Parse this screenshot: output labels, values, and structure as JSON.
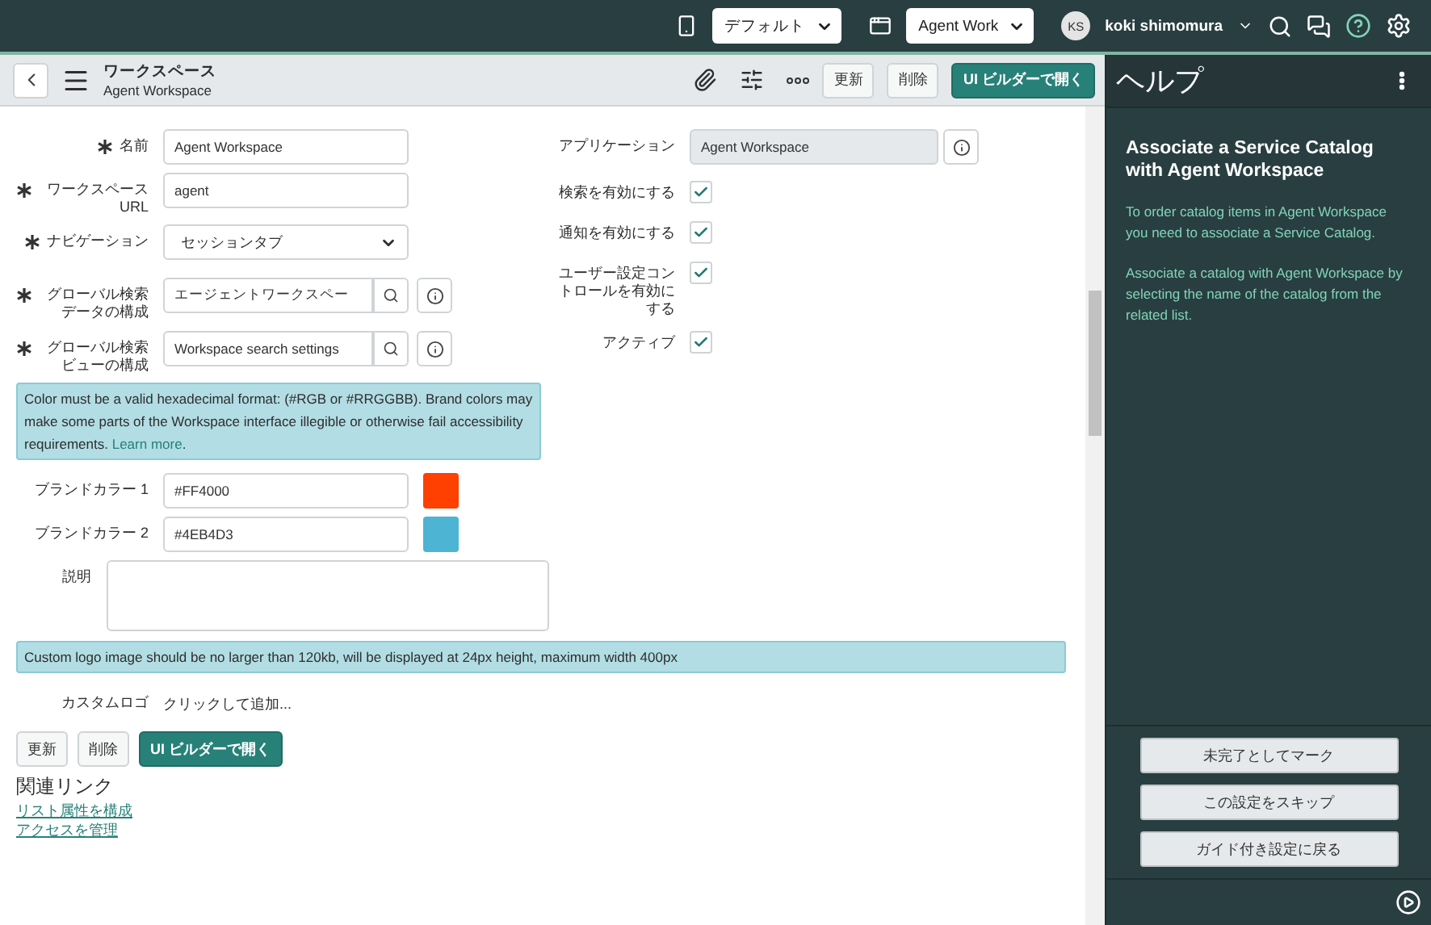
{
  "topbar": {
    "update_set": "デフォルト",
    "application": "Agent Work",
    "user_initials": "KS",
    "user_name": "koki shimomura"
  },
  "header": {
    "title": "ワークスペース",
    "subtitle": "Agent Workspace",
    "buttons": [
      "更新",
      "削除"
    ],
    "primary_button": "UI ビルダーで開く"
  },
  "left_fields": [
    {
      "kind": "text",
      "label": "名前",
      "required": true,
      "value": "Agent Workspace"
    },
    {
      "kind": "text",
      "label": "ワークスペース URL",
      "required": true,
      "value": "agent"
    },
    {
      "kind": "select",
      "label": "ナビゲーション",
      "required": true,
      "value": "セッションタブ"
    },
    {
      "kind": "reference",
      "label": "グローバル検索データの構成",
      "required": true,
      "value": "エージェントワークスペー"
    },
    {
      "kind": "reference",
      "label": "グローバル検索ビューの構成",
      "required": true,
      "value": "Workspace search settings"
    }
  ],
  "right_fields": [
    {
      "kind": "readonly",
      "label": "アプリケーション",
      "value": "Agent Workspace"
    },
    {
      "kind": "checkbox",
      "label": "検索を有効にする",
      "checked": true
    },
    {
      "kind": "checkbox",
      "label": "通知を有効にする",
      "checked": true
    },
    {
      "kind": "checkbox",
      "label": "ユーザー設定コントロールを有効にする",
      "checked": true
    },
    {
      "kind": "checkbox",
      "label": "アクティブ",
      "checked": true
    }
  ],
  "color_message": {
    "text": "Color must be a valid hexadecimal format: (#RGB or #RRGGBB). Brand colors may make some parts of the Workspace interface illegible or otherwise fail accessibility requirements.",
    "link": "Learn more",
    "after": "."
  },
  "brand_colors": [
    {
      "label": "ブランドカラー 1",
      "value": "#FF4000",
      "color": "#ff4000"
    },
    {
      "label": "ブランドカラー 2",
      "value": "#4EB4D3",
      "color": "#4eb4d3"
    }
  ],
  "description_label": "説明",
  "logo_message": "Custom logo image should be no larger than 120kb, will be displayed at 24px height, maximum width 400px",
  "custom_logo": {
    "label": "カスタムロゴ",
    "value": "クリックして追加..."
  },
  "footer": {
    "buttons": [
      "更新",
      "削除"
    ],
    "primary_button": "UI ビルダーで開く"
  },
  "related_links": {
    "title": "関連リンク",
    "links": [
      "リスト属性を構成",
      "アクセスを管理"
    ]
  },
  "help": {
    "title": "ヘルプ",
    "heading": "Associate a Service Catalog with Agent Workspace",
    "paragraphs": [
      "To order catalog items in Agent Workspace you need to associate a Service Catalog.",
      "Associate a catalog with Agent Workspace by selecting the name of the catalog from the related list."
    ],
    "buttons": [
      "未完了としてマーク",
      "この設定をスキップ",
      "ガイド付き設定に戻る"
    ]
  }
}
